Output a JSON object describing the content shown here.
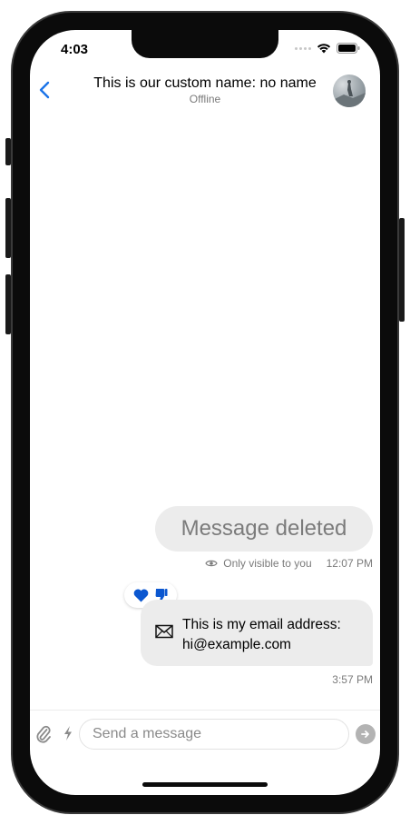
{
  "status_bar": {
    "time": "4:03"
  },
  "header": {
    "title": "This is our custom name: no name",
    "subtitle": "Offline",
    "back_icon": "chevron-left-icon",
    "accent_color": "#1a73e8"
  },
  "messages": [
    {
      "type": "deleted",
      "text": "Message deleted",
      "visibility_note": "Only visible to you",
      "time": "12:07 PM",
      "visibility_icon": "eye-icon"
    },
    {
      "type": "email",
      "text_line1": "This is my email address:",
      "text_line2": "hi@example.com",
      "time": "3:57 PM",
      "icon": "envelope-icon",
      "reactions": [
        "heart-icon",
        "thumbs-down-icon"
      ],
      "reaction_color": "#0b57d0"
    }
  ],
  "composer": {
    "placeholder": "Send a message",
    "attach_icon": "paperclip-icon",
    "commands_icon": "lightning-icon",
    "send_icon": "send-arrow-icon"
  }
}
